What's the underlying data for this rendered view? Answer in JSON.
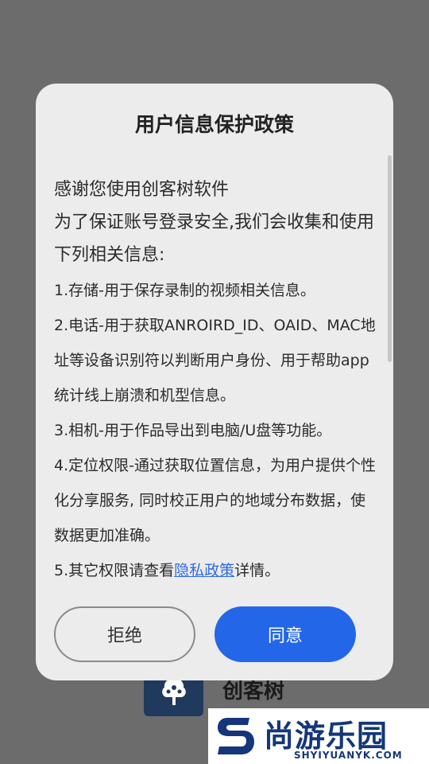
{
  "background_app": {
    "name": "创客树",
    "logo_icon": "tree-icon"
  },
  "dialog": {
    "title": "用户信息保护政策",
    "intro": [
      "感谢您使用创客树软件",
      "为了保证账号登录安全,我们会收集和使用下列相关信息:"
    ],
    "items": [
      "1.存储-用于保存录制的视频相关信息。",
      "2.电话-用于获取ANROIRD_ID、OAID、MAC地址等设备识别符以判断用户身份、用于帮助app统计线上崩溃和机型信息。",
      "3.相机-用于作品导出到电脑/U盘等功能。",
      "4.定位权限-通过获取位置信息，为用户提供个性化分享服务, 同时校正用户的地域分布数据，使数据更加准确。"
    ],
    "last_item": {
      "prefix": "5.其它权限请查看",
      "link": "隐私政策",
      "suffix": "详情。"
    },
    "reject_label": "拒绝",
    "agree_label": "同意"
  },
  "watermark": {
    "text": "尚游乐园",
    "url": "SHYIYUANYK.COM"
  },
  "colors": {
    "accent": "#2367e8",
    "link": "#2e6be6",
    "overlay": "#6c6c6c",
    "dialog_bg": "#ececec"
  }
}
